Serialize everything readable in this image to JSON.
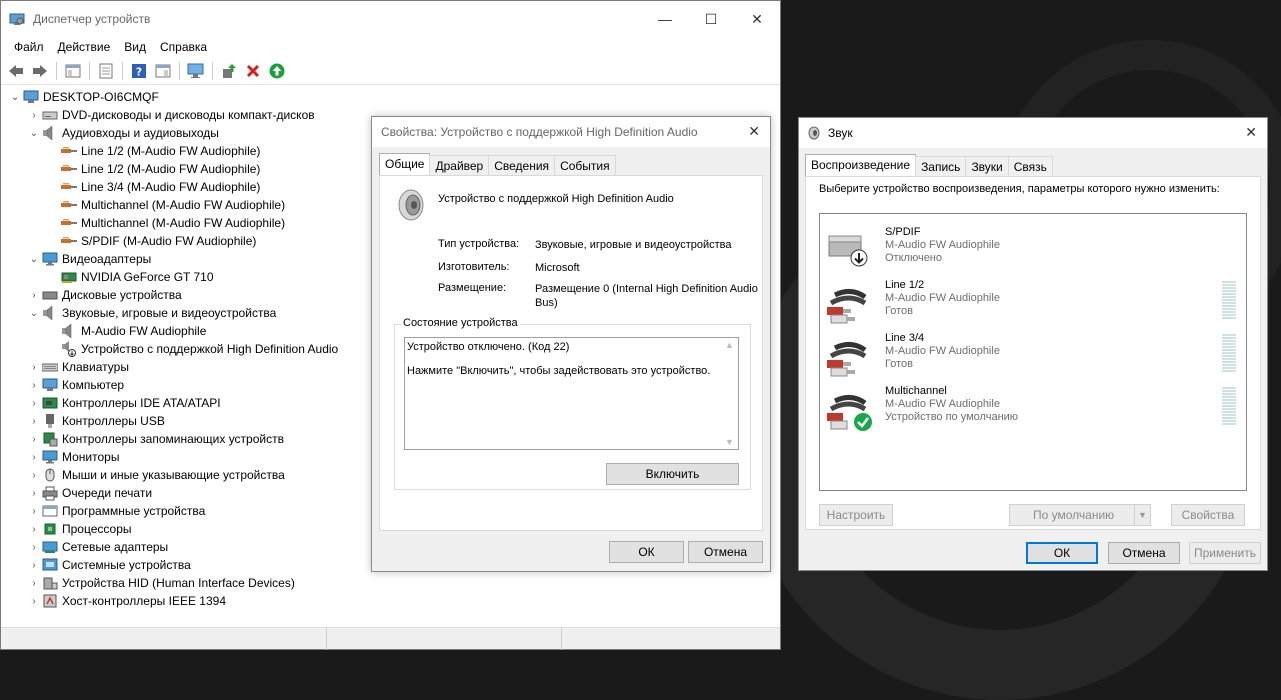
{
  "devmgr": {
    "title": "Диспетчер устройств",
    "window_buttons": [
      "—",
      "☐",
      "✕"
    ],
    "menu": [
      "Файл",
      "Действие",
      "Вид",
      "Справка"
    ],
    "root": "DESKTOP-OI6CMQF",
    "tree": [
      {
        "label": "DVD-дисководы и дисководы компакт-дисков",
        "level": 1,
        "exp": "›",
        "icon": "dvd-drive-icon"
      },
      {
        "label": "Аудиовходы и аудиовыходы",
        "level": 1,
        "exp": "⌄",
        "icon": "speaker-icon"
      },
      {
        "label": "Line 1/2 (M-Audio FW Audiophile)",
        "level": 2,
        "exp": "",
        "icon": "audio-jack-icon"
      },
      {
        "label": "Line 1/2 (M-Audio FW Audiophile)",
        "level": 2,
        "exp": "",
        "icon": "audio-jack-icon"
      },
      {
        "label": "Line 3/4 (M-Audio FW Audiophile)",
        "level": 2,
        "exp": "",
        "icon": "audio-jack-icon"
      },
      {
        "label": "Multichannel (M-Audio FW Audiophile)",
        "level": 2,
        "exp": "",
        "icon": "audio-jack-icon"
      },
      {
        "label": "Multichannel (M-Audio FW Audiophile)",
        "level": 2,
        "exp": "",
        "icon": "audio-jack-icon"
      },
      {
        "label": "S/PDIF (M-Audio FW Audiophile)",
        "level": 2,
        "exp": "",
        "icon": "audio-jack-icon"
      },
      {
        "label": "Видеоадаптеры",
        "level": 1,
        "exp": "⌄",
        "icon": "monitor-icon"
      },
      {
        "label": "NVIDIA GeForce GT 710",
        "level": 2,
        "exp": "",
        "icon": "display-adapter-icon"
      },
      {
        "label": "Дисковые устройства",
        "level": 1,
        "exp": "›",
        "icon": "disk-drive-icon"
      },
      {
        "label": "Звуковые, игровые и видеоустройства",
        "level": 1,
        "exp": "⌄",
        "icon": "speaker-icon"
      },
      {
        "label": "M-Audio FW Audiophile",
        "level": 2,
        "exp": "",
        "icon": "speaker-icon"
      },
      {
        "label": "Устройство с поддержкой High Definition Audio",
        "level": 2,
        "exp": "",
        "icon": "disabled-speaker-icon"
      },
      {
        "label": "Клавиатуры",
        "level": 1,
        "exp": "›",
        "icon": "keyboard-icon"
      },
      {
        "label": "Компьютер",
        "level": 1,
        "exp": "›",
        "icon": "computer-icon"
      },
      {
        "label": "Контроллеры IDE ATA/ATAPI",
        "level": 1,
        "exp": "›",
        "icon": "controller-icon"
      },
      {
        "label": "Контроллеры USB",
        "level": 1,
        "exp": "›",
        "icon": "usb-icon"
      },
      {
        "label": "Контроллеры запоминающих устройств",
        "level": 1,
        "exp": "›",
        "icon": "storage-controller-icon"
      },
      {
        "label": "Мониторы",
        "level": 1,
        "exp": "›",
        "icon": "monitor-icon"
      },
      {
        "label": "Мыши и иные указывающие устройства",
        "level": 1,
        "exp": "›",
        "icon": "mouse-icon"
      },
      {
        "label": "Очереди печати",
        "level": 1,
        "exp": "›",
        "icon": "printer-icon"
      },
      {
        "label": "Программные устройства",
        "level": 1,
        "exp": "›",
        "icon": "software-device-icon"
      },
      {
        "label": "Процессоры",
        "level": 1,
        "exp": "›",
        "icon": "processor-icon"
      },
      {
        "label": "Сетевые адаптеры",
        "level": 1,
        "exp": "›",
        "icon": "network-adapter-icon"
      },
      {
        "label": "Системные устройства",
        "level": 1,
        "exp": "›",
        "icon": "system-device-icon"
      },
      {
        "label": "Устройства HID (Human Interface Devices)",
        "level": 1,
        "exp": "›",
        "icon": "hid-icon"
      },
      {
        "label": "Хост-контроллеры IEEE 1394",
        "level": 1,
        "exp": "›",
        "icon": "firewire-icon"
      }
    ]
  },
  "props": {
    "title": "Свойства: Устройство с поддержкой High Definition Audio",
    "tabs": [
      "Общие",
      "Драйвер",
      "Сведения",
      "События"
    ],
    "device_name": "Устройство с поддержкой High Definition Audio",
    "type_label": "Тип устройства:",
    "type_value": "Звуковые, игровые и видеоустройства",
    "maker_label": "Изготовитель:",
    "maker_value": "Microsoft",
    "location_label": "Размещение:",
    "location_value": "Размещение 0 (Internal High Definition Audio Bus)",
    "status_group": "Состояние устройства",
    "status_line1": "Устройство отключено. (Код 22)",
    "status_line2": "Нажмите \"Включить\", чтобы задействовать это устройство.",
    "enable_btn": "Включить",
    "ok": "ОК",
    "cancel": "Отмена"
  },
  "sound": {
    "title": "Звук",
    "tabs": [
      "Воспроизведение",
      "Запись",
      "Звуки",
      "Связь"
    ],
    "description": "Выберите устройство воспроизведения, параметры которого нужно изменить:",
    "devices": [
      {
        "name": "S/PDIF",
        "driver": "M-Audio FW Audiophile",
        "status": "Отключено",
        "icon": "spdif-device-icon"
      },
      {
        "name": "Line 1/2",
        "driver": "M-Audio FW Audiophile",
        "status": "Готов",
        "icon": "rca-cable-icon"
      },
      {
        "name": "Line 3/4",
        "driver": "M-Audio FW Audiophile",
        "status": "Готов",
        "icon": "rca-cable-icon"
      },
      {
        "name": "Multichannel",
        "driver": "M-Audio FW Audiophile",
        "status": "Устройство по умолчанию",
        "icon": "rca-cable-default-icon"
      }
    ],
    "configure_btn": "Настроить",
    "default_btn": "По умолчанию",
    "properties_btn": "Свойства",
    "ok": "ОК",
    "cancel": "Отмена",
    "apply": "Применить"
  }
}
